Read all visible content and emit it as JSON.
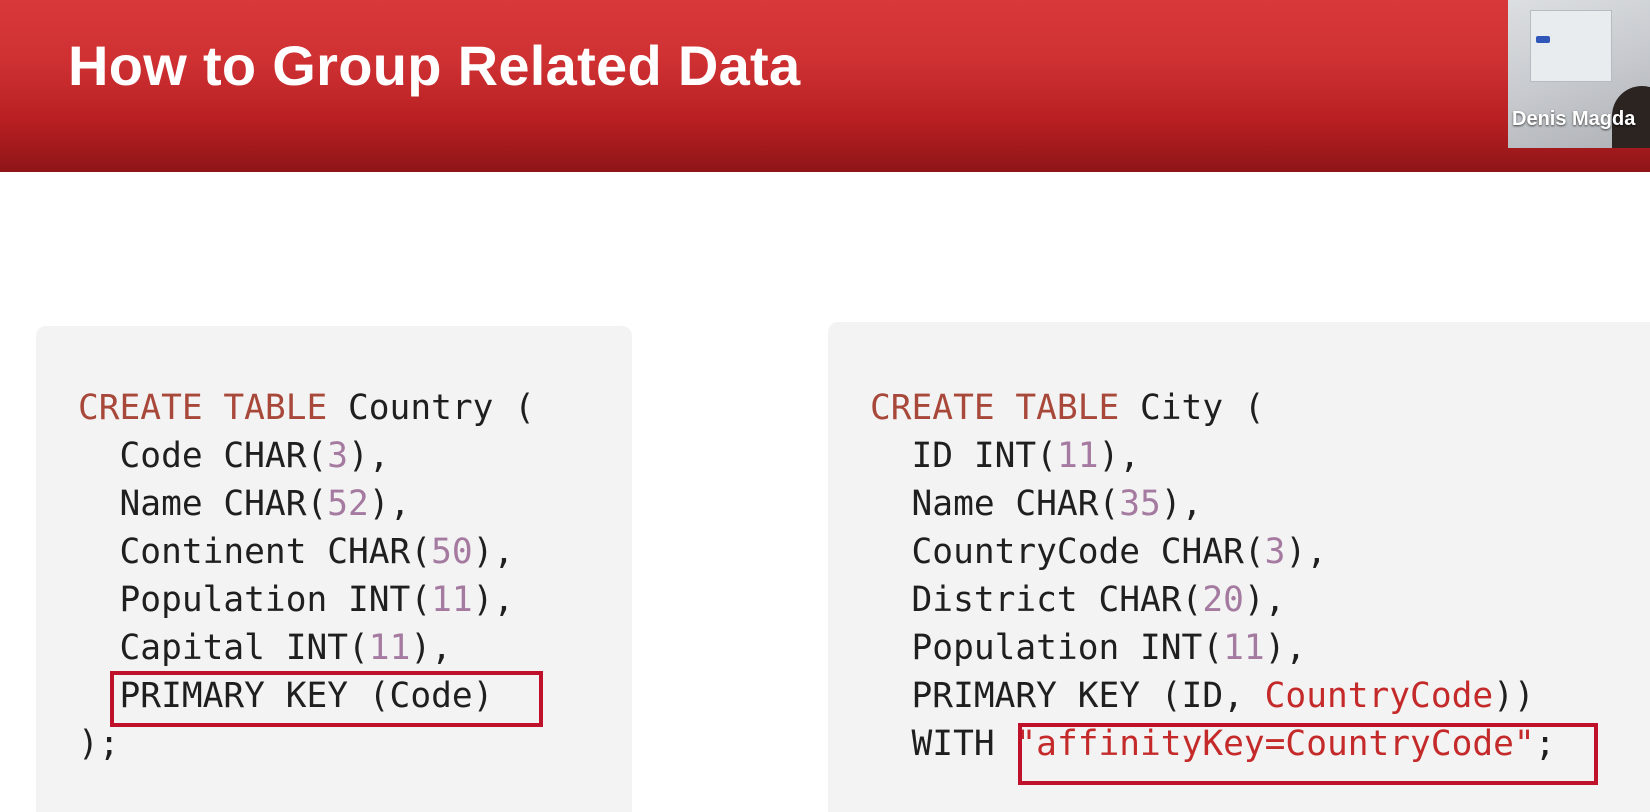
{
  "slide": {
    "title": "How to Group Related Data"
  },
  "webcam": {
    "presenter_name": "Denis Magda"
  },
  "left_code": {
    "lines": [
      [
        {
          "t": "CREATE TABLE",
          "c": "kw"
        },
        {
          "t": " Country ("
        }
      ],
      [
        {
          "t": "  Code CHAR("
        },
        {
          "t": "3",
          "c": "num"
        },
        {
          "t": "),"
        }
      ],
      [
        {
          "t": "  Name CHAR("
        },
        {
          "t": "52",
          "c": "num"
        },
        {
          "t": "),"
        }
      ],
      [
        {
          "t": "  Continent CHAR("
        },
        {
          "t": "50",
          "c": "num"
        },
        {
          "t": "),"
        }
      ],
      [
        {
          "t": "  Population INT("
        },
        {
          "t": "11",
          "c": "num"
        },
        {
          "t": "),"
        }
      ],
      [
        {
          "t": "  Capital INT("
        },
        {
          "t": "11",
          "c": "num"
        },
        {
          "t": "),"
        }
      ],
      [
        {
          "t": "  PRIMARY KEY (Code)"
        }
      ],
      [
        {
          "t": ");"
        }
      ]
    ]
  },
  "right_code": {
    "lines": [
      [
        {
          "t": "CREATE TABLE",
          "c": "kw"
        },
        {
          "t": " City ("
        }
      ],
      [
        {
          "t": "  ID INT("
        },
        {
          "t": "11",
          "c": "num"
        },
        {
          "t": "),"
        }
      ],
      [
        {
          "t": "  Name CHAR("
        },
        {
          "t": "35",
          "c": "num"
        },
        {
          "t": "),"
        }
      ],
      [
        {
          "t": "  CountryCode CHAR("
        },
        {
          "t": "3",
          "c": "num"
        },
        {
          "t": "),"
        }
      ],
      [
        {
          "t": "  District CHAR("
        },
        {
          "t": "20",
          "c": "num"
        },
        {
          "t": "),"
        }
      ],
      [
        {
          "t": "  Population INT("
        },
        {
          "t": "11",
          "c": "num"
        },
        {
          "t": "),"
        }
      ],
      [
        {
          "t": "  PRIMARY KEY (ID, "
        },
        {
          "t": "CountryCode",
          "c": "str"
        },
        {
          "t": "))"
        }
      ],
      [
        {
          "t": "  WITH "
        },
        {
          "t": "\"affinityKey=CountryCode\"",
          "c": "str"
        },
        {
          "t": ";"
        }
      ]
    ]
  },
  "colors": {
    "banner_red": "#cf3133",
    "keyword": "#a8483a",
    "number": "#a57aa0",
    "string": "#c42a2a",
    "highlight_box": "#c0112b"
  }
}
